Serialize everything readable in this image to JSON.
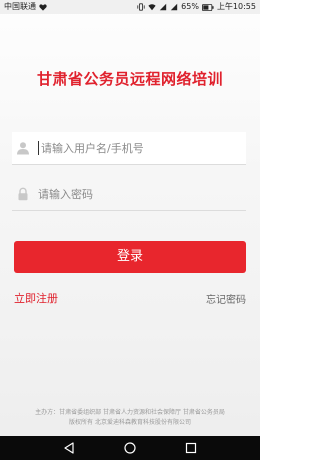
{
  "status_bar": {
    "carrier": "中国联通",
    "battery": "65%",
    "time": "上午10:55"
  },
  "title": "甘肃省公务员远程网络培训",
  "username": {
    "placeholder": "请输入用户名/手机号",
    "icon": "user-icon"
  },
  "password": {
    "placeholder": "请输入密码",
    "icon": "lock-icon"
  },
  "login_button": "登录",
  "register_link": "立即注册",
  "forgot_link": "忘记密码",
  "footer": {
    "line1": "主办方：甘肃省委组织部 甘肃省人力资源和社会保障厅 甘肃省公务员局",
    "line2": "版权所有 北京爱迪科森教育科技股份有限公司"
  },
  "colors": {
    "accent": "#e8262d",
    "title": "#e0212d"
  }
}
